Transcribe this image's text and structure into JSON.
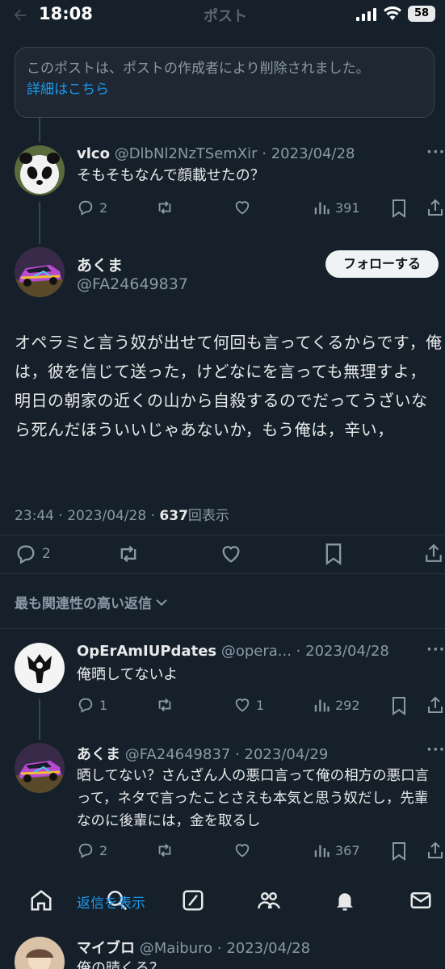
{
  "status_bar": {
    "time": "18:08",
    "battery": "58"
  },
  "header": {
    "title": "ポスト"
  },
  "deleted_notice": {
    "text": "このポストは、ポストの作成者により削除されました。",
    "link": "詳細はこちら"
  },
  "replies_top": {
    "name": "vlco",
    "meta": "@DlbNl2NzTSemXir · 2023/04/28",
    "text": "そもそもなんで顔載せたの？",
    "reply_count": "2",
    "retweet_count": "",
    "like_count": "",
    "view_count": "391"
  },
  "main_post": {
    "name": "あくま",
    "handle": "@FA24649837",
    "follow_label": "フォローする",
    "text": "オペラミと言う奴が出せて何回も言ってくるからです，俺は，彼を信じて送った，けどなにを言っても無理すよ，明日の朝家の近くの山から自殺するのでだってうざいなら死んだほういいじゃあないか，もう俺は，辛い，",
    "time_date": "23:44 · 2023/04/28 · ",
    "views": "637",
    "views_label": "回表示",
    "reply_count": "2"
  },
  "sort": {
    "label": "最も関連性の高い返信"
  },
  "replies": [
    {
      "name": "OpErAmIUPdates",
      "meta": "@opera... · 2023/04/28",
      "text": "俺晒してないよ",
      "reply_count": "1",
      "like_count": "1",
      "view_count": "292"
    },
    {
      "name": "あくま",
      "meta": "@FA24649837 · 2023/04/29",
      "text": "晒してない？さんざん人の悪口言って俺の相方の悪口言って，ネタで言ったことさえも本気と思う奴だし，先輩なのに後輩には，金を取るし",
      "reply_count": "2",
      "view_count": "367"
    }
  ],
  "show_replies": "返信を表示",
  "last_reply": {
    "name": "マイブロ",
    "meta": "@Maiburo · 2023/04/28",
    "text": "俺の晴くろ？"
  },
  "colors": {
    "background": "#15202b",
    "accent": "#1d9bf0",
    "muted": "#8b98a5"
  }
}
